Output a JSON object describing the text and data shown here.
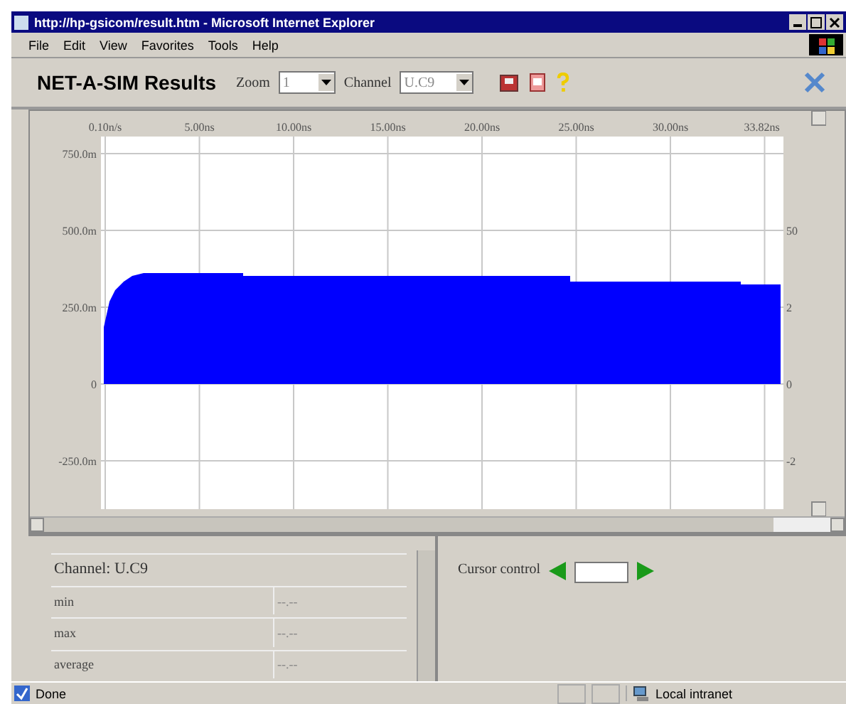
{
  "window": {
    "title": "http://hp-gsicom/result.htm - Microsoft Internet Explorer"
  },
  "menu": [
    "File",
    "Edit",
    "View",
    "Favorites",
    "Tools",
    "Help"
  ],
  "toolbar": {
    "title": "NET-A-SIM Results",
    "zoom_label": "Zoom",
    "zoom_value": "1",
    "channel_label": "Channel",
    "channel_value": "U.C9"
  },
  "plot": {
    "x_labels": [
      "0.10n/s",
      "5.00ns",
      "10.00ns",
      "15.00ns",
      "20.00ns",
      "25.00ns",
      "30.00ns",
      "33.82ns"
    ],
    "y_labels": [
      "750.0m",
      "500.0m",
      "250.0m",
      "0",
      "-250.0m"
    ],
    "right_labels": [
      "50",
      "2",
      "0",
      "-2"
    ]
  },
  "stats": {
    "heading": "Channel: U.C9",
    "rows": [
      {
        "label": "min",
        "value": "--.--"
      },
      {
        "label": "max",
        "value": "--.--"
      },
      {
        "label": "average",
        "value": "--.--"
      }
    ]
  },
  "cursor": {
    "label": "Cursor control"
  },
  "status_bar": {
    "text": "Done",
    "zone": "Local intranet"
  }
}
